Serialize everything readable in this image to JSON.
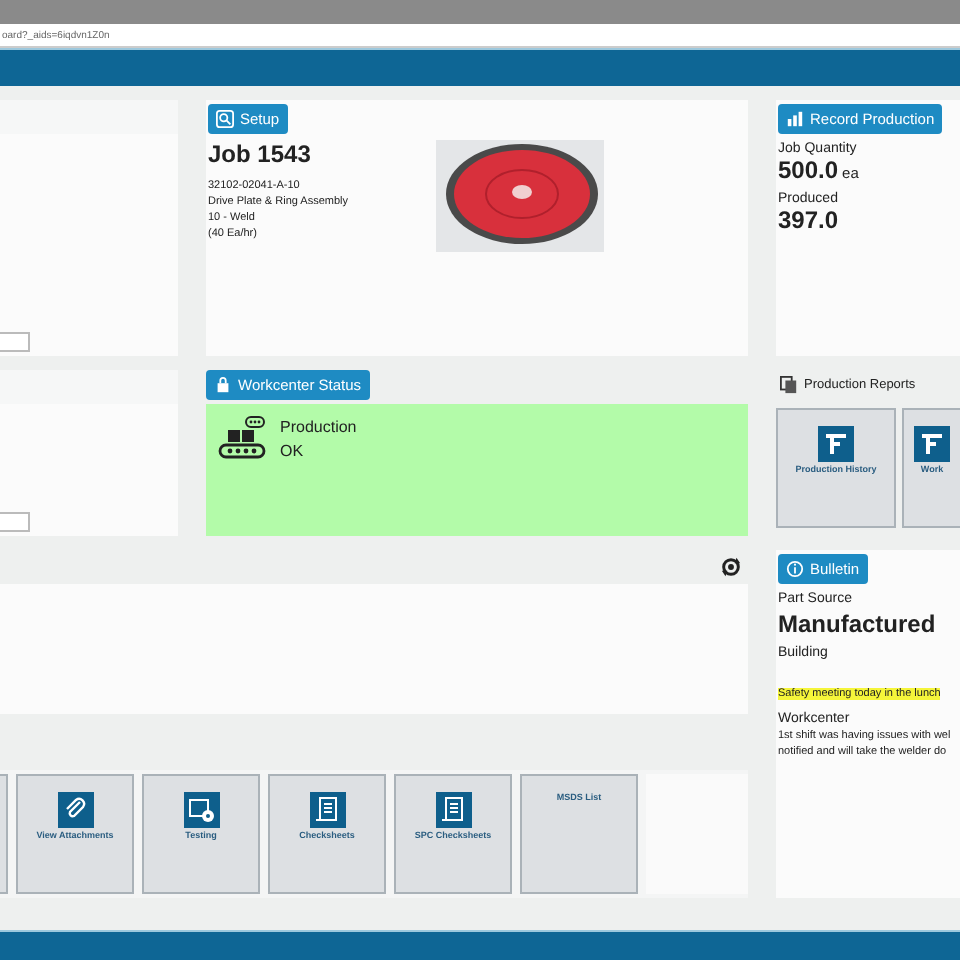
{
  "browser": {
    "url": "oard?_aids=6iqdvn1Z0n"
  },
  "setup": {
    "button": "Setup",
    "job": "Job 1543",
    "details": [
      "32102-02041-A-10",
      "Drive Plate & Ring Assembly",
      "10 - Weld",
      "(40 Ea/hr)"
    ]
  },
  "record": {
    "button": "Record Production",
    "quantity_label": "Job Quantity",
    "quantity": "500.0",
    "unit": "ea",
    "produced_label": "Produced",
    "produced": "397.0"
  },
  "workcenter_status": {
    "button": "Workcenter Status",
    "status": "Production",
    "condition": "OK"
  },
  "production_reports": {
    "title": "Production Reports",
    "tiles": [
      {
        "label": "Production History"
      },
      {
        "label": "Work"
      }
    ]
  },
  "bulletin": {
    "button": "Bulletin",
    "part_source_label": "Part Source",
    "part_source": "Manufactured",
    "building_label": "Building",
    "notice": "Safety meeting today in the lunch",
    "workcenter_label": "Workcenter",
    "workcenter_lines": [
      "1st shift was having issues with wel",
      "notified and will take the welder do"
    ]
  },
  "tiles": [
    {
      "kind": "blank"
    },
    {
      "kind": "attachment",
      "label": "View Attachments"
    },
    {
      "kind": "testing",
      "label": "Testing"
    },
    {
      "kind": "checksheet",
      "label": "Checksheets"
    },
    {
      "kind": "checksheet",
      "label": "SPC Checksheets"
    },
    {
      "kind": "text",
      "label": "MSDS List"
    }
  ]
}
